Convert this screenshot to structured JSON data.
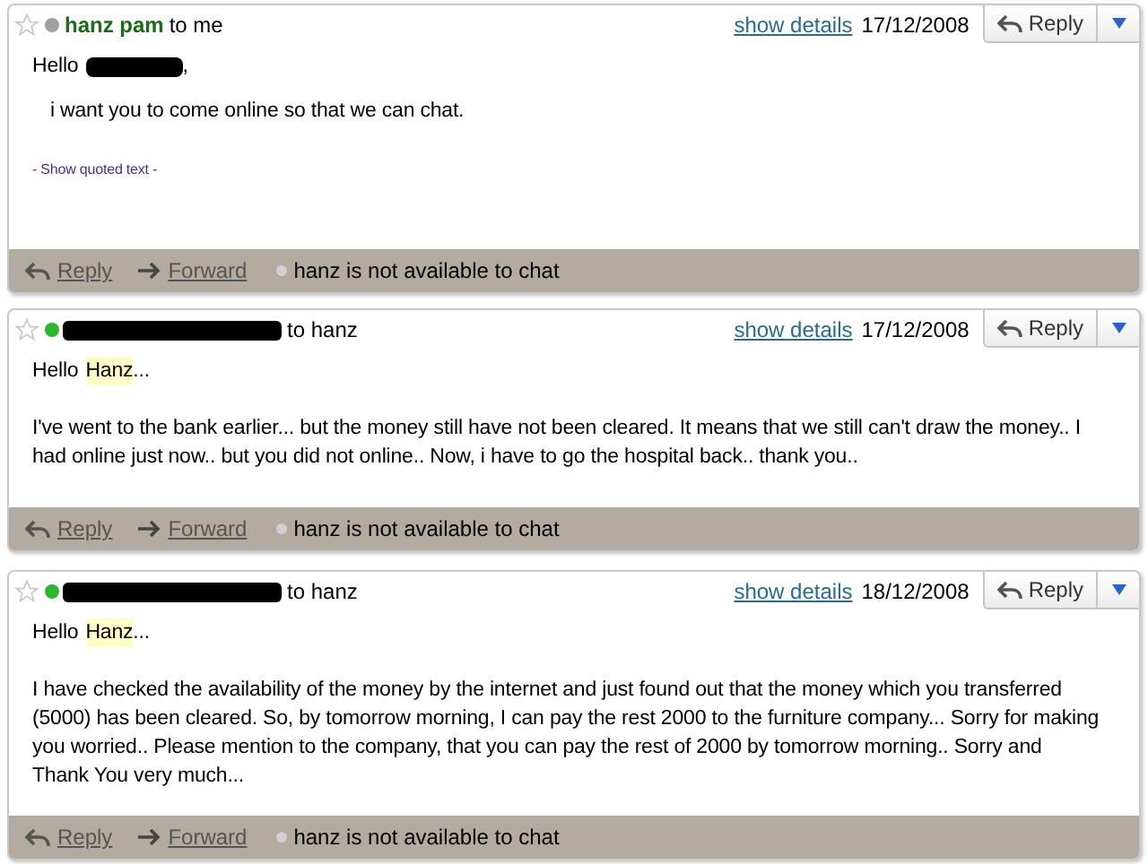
{
  "messages": [
    {
      "starred": false,
      "sender": {
        "kind": "name",
        "text": "hanz pam"
      },
      "online": false,
      "recipient": "to me",
      "details_link": "show details",
      "date": "17/12/2008",
      "reply_button": "Reply",
      "greeting": {
        "before": "Hello",
        "mark": {
          "kind": "redacted"
        },
        "after": ","
      },
      "paragraphs": [
        {
          "kind": "indented",
          "text": "i want you to come online so that we can chat."
        },
        {
          "kind": "quoted-link",
          "text": "- Show quoted text -"
        }
      ],
      "footer": {
        "reply": "Reply",
        "forward": "Forward",
        "chat_status": "hanz is not available to chat"
      }
    },
    {
      "starred": false,
      "sender": {
        "kind": "redacted"
      },
      "online": true,
      "recipient": "to hanz",
      "details_link": "show details",
      "date": "17/12/2008",
      "reply_button": "Reply",
      "greeting": {
        "before": "Hello",
        "mark": {
          "kind": "highlight",
          "text": "Hanz"
        },
        "after": "..."
      },
      "paragraphs": [
        {
          "kind": "plain",
          "text": "I've went to the bank earlier... but the money still have not been cleared. It means that we still can't draw the money.. I had online just now.. but you did not online.. Now, i have to go the hospital back.. thank you.."
        }
      ],
      "footer": {
        "reply": "Reply",
        "forward": "Forward",
        "chat_status": "hanz is not available to chat"
      }
    },
    {
      "starred": false,
      "sender": {
        "kind": "redacted"
      },
      "online": true,
      "recipient": "to hanz",
      "details_link": "show details",
      "date": "18/12/2008",
      "reply_button": "Reply",
      "greeting": {
        "before": "Hello",
        "mark": {
          "kind": "highlight",
          "text": "Hanz"
        },
        "after": "..."
      },
      "paragraphs": [
        {
          "kind": "plain",
          "text": "I have checked the availability of the money by the internet and just found out that the money which you transferred (5000) has been cleared. So, by tomorrow morning, I can pay the rest 2000 to the furniture company... Sorry for making you worried.. Please mention to the company, that you can pay the rest of 2000 by tomorrow morning.. Sorry and Thank You very much..."
        }
      ],
      "footer": {
        "reply": "Reply",
        "forward": "Forward",
        "chat_status": "hanz is not available to chat"
      }
    }
  ]
}
